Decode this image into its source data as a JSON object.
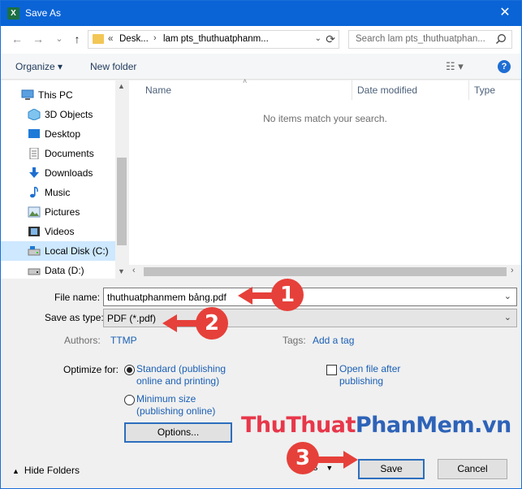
{
  "window": {
    "title": "Save As",
    "app_icon": "X",
    "close_glyph": "✕"
  },
  "nav": {
    "back": "←",
    "forward": "→",
    "recent": "⌄",
    "up": "↑",
    "breadcrumb": [
      "Desk...",
      "lam pts_thuthuatphanm..."
    ],
    "breadcrumb_prefix": "«",
    "search_placeholder": "Search lam pts_thuthuatphan..."
  },
  "toolbar": {
    "organize": "Organize ▾",
    "new_folder": "New folder",
    "view": "☷ ▾",
    "help": "?"
  },
  "sidebar": {
    "items": [
      {
        "label": "This PC",
        "icon": "this-pc-icon"
      },
      {
        "label": "3D Objects",
        "icon": "3d-objects-icon"
      },
      {
        "label": "Desktop",
        "icon": "desktop-icon"
      },
      {
        "label": "Documents",
        "icon": "documents-icon"
      },
      {
        "label": "Downloads",
        "icon": "downloads-icon"
      },
      {
        "label": "Music",
        "icon": "music-icon"
      },
      {
        "label": "Pictures",
        "icon": "pictures-icon"
      },
      {
        "label": "Videos",
        "icon": "videos-icon"
      },
      {
        "label": "Local Disk (C:)",
        "icon": "local-disk-icon",
        "selected": true
      },
      {
        "label": "Data (D:)",
        "icon": "data-drive-icon"
      }
    ]
  },
  "files": {
    "columns": [
      "Name",
      "Date modified",
      "Type"
    ],
    "empty_message": "No items match your search."
  },
  "form": {
    "file_name_label": "File name:",
    "file_name_value": "thuthuatphanmem bảng.pdf",
    "save_type_label": "Save as type:",
    "save_type_value": "PDF (*.pdf)",
    "authors_label": "Authors:",
    "authors_value": "TTMP",
    "tags_label": "Tags:",
    "tags_value": "Add a tag",
    "optimize_label": "Optimize for:",
    "opt_standard": [
      "Standard (publishing",
      "online and printing)"
    ],
    "opt_minimum": [
      "Minimum size",
      "(publishing online)"
    ],
    "open_after": [
      "Open file after",
      "publishing"
    ],
    "options_button": "Options...",
    "hide_folders": "Hide Folders",
    "tools": "ols",
    "save_button": "Save",
    "cancel_button": "Cancel"
  },
  "watermark": {
    "part1": "ThuThuat",
    "part2": "PhanMem",
    "part3": ".vn"
  },
  "callouts": [
    "1",
    "2",
    "3"
  ],
  "colors": {
    "titlebar": "#0a64d6",
    "callout": "#e6403a",
    "link": "#1a5fb4"
  }
}
